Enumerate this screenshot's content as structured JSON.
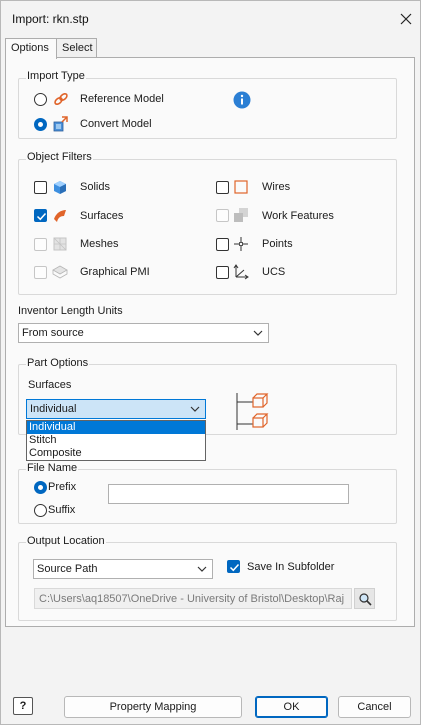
{
  "window": {
    "title": "Import: rkn.stp"
  },
  "tabs": [
    {
      "label": "Options"
    },
    {
      "label": "Select"
    }
  ],
  "import_type": {
    "label": "Import Type",
    "options": [
      {
        "label": "Reference Model",
        "checked": false
      },
      {
        "label": "Convert Model",
        "checked": true
      }
    ]
  },
  "object_filters": {
    "label": "Object Filters",
    "items": [
      {
        "label": "Solids",
        "checked": false,
        "enabled": true
      },
      {
        "label": "Wires",
        "checked": false,
        "enabled": true
      },
      {
        "label": "Surfaces",
        "checked": true,
        "enabled": true
      },
      {
        "label": "Work Features",
        "checked": false,
        "enabled": false
      },
      {
        "label": "Meshes",
        "checked": false,
        "enabled": false
      },
      {
        "label": "Points",
        "checked": false,
        "enabled": true
      },
      {
        "label": "Graphical PMI",
        "checked": false,
        "enabled": false
      },
      {
        "label": "UCS",
        "checked": false,
        "enabled": true
      }
    ]
  },
  "length_units": {
    "label": "Inventor Length Units",
    "value": "From source"
  },
  "part_options": {
    "label": "Part Options",
    "surfaces_label": "Surfaces",
    "surfaces_value": "Individual",
    "surfaces_options": [
      "Individual",
      "Stitch",
      "Composite"
    ]
  },
  "file_name": {
    "label": "File Name",
    "prefix_label": "Prefix",
    "suffix_label": "Suffix",
    "value": ""
  },
  "output_location": {
    "label": "Output Location",
    "location_value": "Source Path",
    "save_subfolder_label": "Save In Subfolder",
    "save_subfolder_checked": true,
    "path": "C:\\Users\\aq18507\\OneDrive - University of Bristol\\Desktop\\Raj"
  },
  "buttons": {
    "help": "?",
    "property_mapping": "Property Mapping",
    "ok": "OK",
    "cancel": "Cancel"
  },
  "colors": {
    "accent": "#0067c0",
    "icon_orange": "#e0642a",
    "info_blue": "#2b7fd4"
  }
}
